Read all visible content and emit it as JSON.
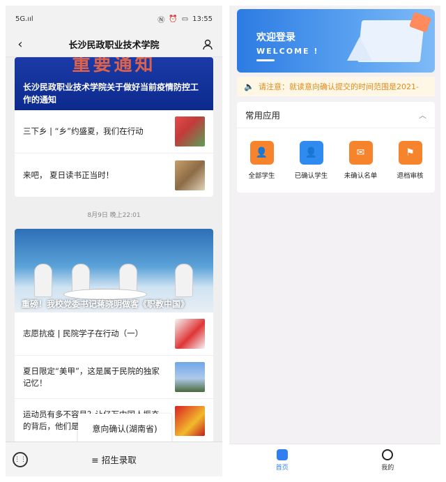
{
  "left": {
    "status": {
      "time": "13:55",
      "signal": "5G.ııl",
      "battery": ""
    },
    "nav": {
      "title": "长沙民政职业技术学院"
    },
    "hero1": {
      "banner": "重要通知",
      "title": "长沙民政职业技术学院关于做好当前疫情防控工作的通知"
    },
    "group1": [
      {
        "text": "三下乡 | “乡”约盛夏，我们在行动"
      },
      {
        "text": "来吧， 夏日读书正当时！"
      }
    ],
    "timestamp": "8月9日 晚上22:01",
    "hero2": {
      "title": "重磅！我校党委书记蒋晓明做客《职教中国》"
    },
    "group2": [
      {
        "text": "志愿抗疫 | 民院学子在行动（一）"
      },
      {
        "text": "夏日限定“美甲”，这是属于民院的独家记忆！"
      },
      {
        "text": "运动员有多不容易？让亿万中国人振奋的背后，他们是这样拼过来的"
      }
    ],
    "popup": "意向确认(湖南省)",
    "bottom": {
      "menu_label": "≡ 招生录取"
    }
  },
  "right": {
    "welcome": {
      "title": "欢迎登录",
      "subtitle": "WELCOME !"
    },
    "notice": "请注意：就读意向确认提交的时间范围是2021-",
    "apps": {
      "header": "常用应用",
      "items": [
        {
          "label": "全部学生",
          "color": "#f5842c",
          "icon": "person-icon"
        },
        {
          "label": "已确认学生",
          "color": "#2f8bf0",
          "icon": "person-check-icon"
        },
        {
          "label": "未确认名单",
          "color": "#f5842c",
          "icon": "mail-icon"
        },
        {
          "label": "退档审核",
          "color": "#f5842c",
          "icon": "stamp-icon"
        }
      ]
    },
    "tabs": [
      {
        "label": "首页",
        "active": true
      },
      {
        "label": "我的",
        "active": false
      }
    ]
  }
}
